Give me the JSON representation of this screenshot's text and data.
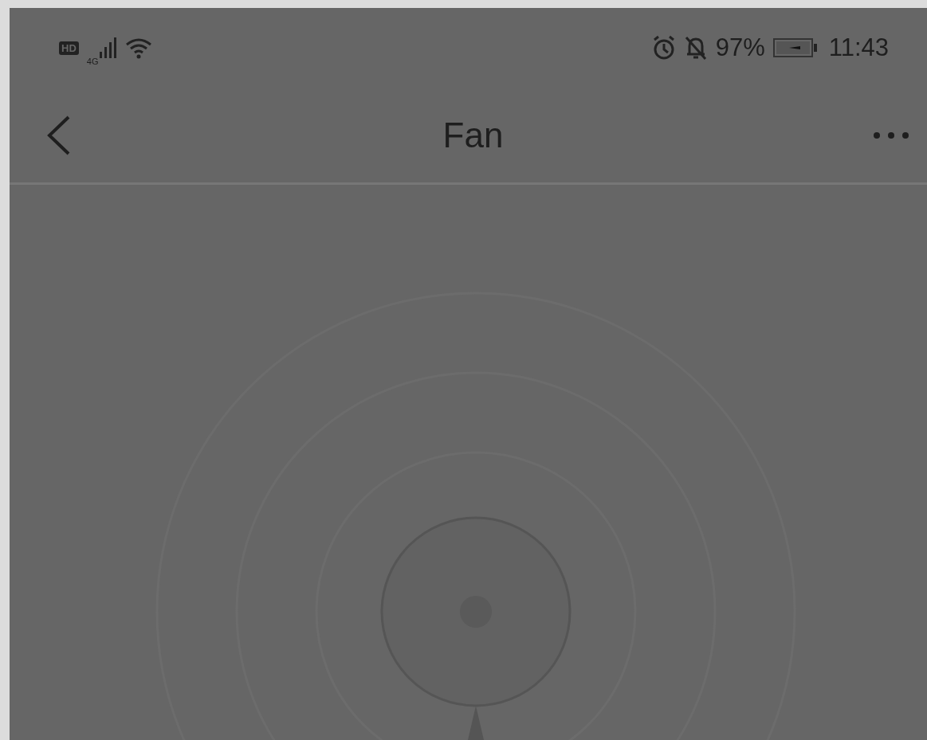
{
  "status_bar": {
    "hd_badge": "HD",
    "network": "4G",
    "battery": "97%",
    "time": "11:43"
  },
  "header": {
    "title": "Fan"
  }
}
